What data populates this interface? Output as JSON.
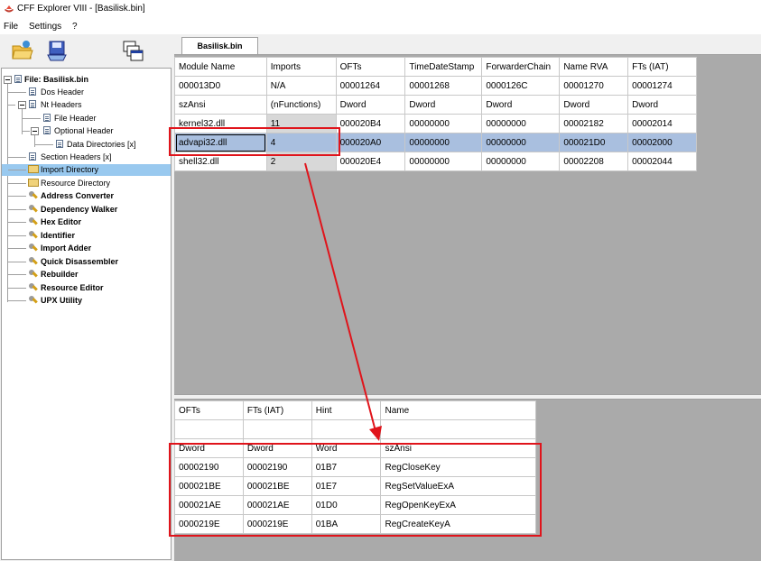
{
  "window": {
    "title": "CFF Explorer VIII - [Basilisk.bin]"
  },
  "menu": [
    {
      "label": "File"
    },
    {
      "label": "Settings"
    },
    {
      "label": "?"
    }
  ],
  "toolbar": {
    "icons": [
      "open-folder-icon",
      "save-disk-icon",
      "windows-cascade-icon"
    ]
  },
  "tree": {
    "root": "File: Basilisk.bin",
    "items": [
      {
        "label": "Dos Header"
      },
      {
        "label": "Nt Headers"
      },
      {
        "label": "File Header"
      },
      {
        "label": "Optional Header"
      },
      {
        "label": "Data Directories [x]"
      },
      {
        "label": "Section Headers [x]"
      },
      {
        "label": "Import Directory"
      },
      {
        "label": "Resource Directory"
      },
      {
        "label": "Address Converter"
      },
      {
        "label": "Dependency Walker"
      },
      {
        "label": "Hex Editor"
      },
      {
        "label": "Identifier"
      },
      {
        "label": "Import Adder"
      },
      {
        "label": "Quick Disassembler"
      },
      {
        "label": "Rebuilder"
      },
      {
        "label": "Resource Editor"
      },
      {
        "label": "UPX Utility"
      }
    ]
  },
  "tab": {
    "label": "Basilisk.bin"
  },
  "modules_table": {
    "headers": [
      "Module Name",
      "Imports",
      "OFTs",
      "TimeDateStamp",
      "ForwarderChain",
      "Name RVA",
      "FTs (IAT)"
    ],
    "offsets": [
      "000013D0",
      "N/A",
      "00001264",
      "00001268",
      "0000126C",
      "00001270",
      "00001274"
    ],
    "types": [
      "szAnsi",
      "(nFunctions)",
      "Dword",
      "Dword",
      "Dword",
      "Dword",
      "Dword"
    ],
    "rows": [
      [
        "kernel32.dll",
        "11",
        "000020B4",
        "00000000",
        "00000000",
        "00002182",
        "00002014"
      ],
      [
        "advapi32.dll",
        "4",
        "000020A0",
        "00000000",
        "00000000",
        "000021D0",
        "00002000"
      ],
      [
        "shell32.dll",
        "2",
        "000020E4",
        "00000000",
        "00000000",
        "00002208",
        "00002044"
      ]
    ]
  },
  "functions_table": {
    "headers": [
      "OFTs",
      "FTs (IAT)",
      "Hint",
      "Name"
    ],
    "types": [
      "Dword",
      "Dword",
      "Word",
      "szAnsi"
    ],
    "rows": [
      [
        "00002190",
        "00002190",
        "01B7",
        "RegCloseKey"
      ],
      [
        "000021BE",
        "000021BE",
        "01E7",
        "RegSetValueExA"
      ],
      [
        "000021AE",
        "000021AE",
        "01D0",
        "RegOpenKeyExA"
      ],
      [
        "0000219E",
        "0000219E",
        "01BA",
        "RegCreateKeyA"
      ]
    ]
  },
  "annotation_color": "#e0141b"
}
